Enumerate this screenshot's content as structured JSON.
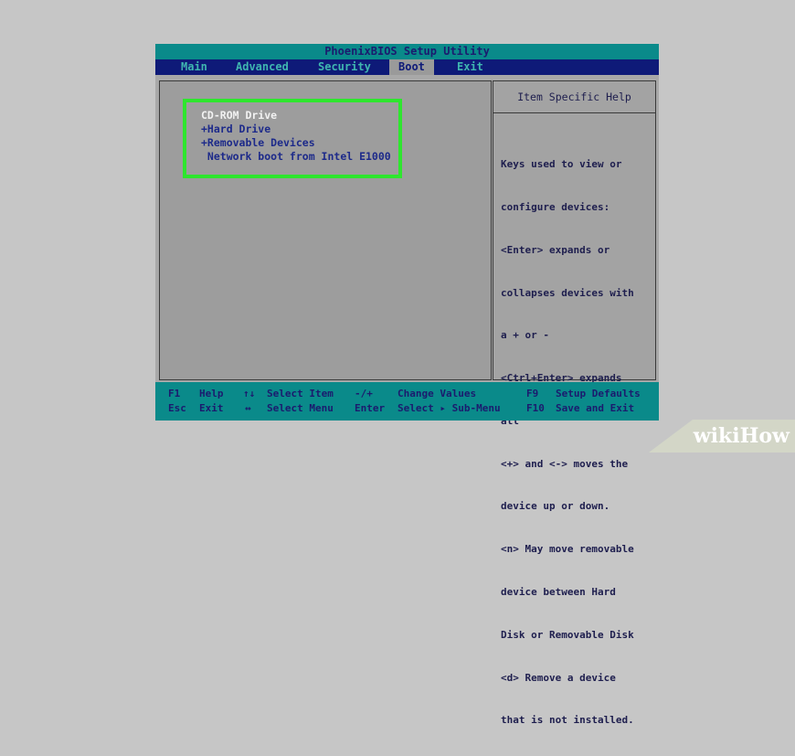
{
  "bios": {
    "title": "PhoenixBIOS Setup Utility",
    "menu": [
      "Main",
      "Advanced",
      "Security",
      "Boot",
      "Exit"
    ],
    "active_menu": "Boot",
    "boot_order": [
      "CD-ROM Drive",
      "+Hard Drive",
      "+Removable Devices",
      " Network boot from Intel E1000"
    ],
    "help": {
      "title": "Item Specific Help",
      "lines": [
        "Keys used to view or",
        "configure devices:",
        "<Enter> expands or",
        "collapses devices with",
        "a + or -",
        "<Ctrl+Enter> expands",
        "all",
        "<+> and <-> moves the",
        "device up or down.",
        "<n> May move removable",
        "device between Hard",
        "Disk or Removable Disk",
        "<d> Remove a device",
        "that is not installed."
      ]
    },
    "footer": {
      "row1": [
        {
          "key": "F1",
          "desc": "Help"
        },
        {
          "key": "↑↓",
          "desc": "Select Item"
        },
        {
          "key": "-/+",
          "desc": "Change Values"
        },
        {
          "key": "F9",
          "desc": "Setup Defaults"
        }
      ],
      "row2": [
        {
          "key": "Esc",
          "desc": "Exit"
        },
        {
          "key": "↔",
          "desc": "Select Menu"
        },
        {
          "key": "Enter",
          "desc": "Select ▸ Sub-Menu"
        },
        {
          "key": "F10",
          "desc": "Save and Exit"
        }
      ]
    }
  },
  "watermark": {
    "wiki": "wiki",
    "how": "How"
  },
  "colors": {
    "highlight_border": "#2ee62e",
    "menu_bg": "#0e1a78",
    "title_bg": "#0a8a8a"
  }
}
